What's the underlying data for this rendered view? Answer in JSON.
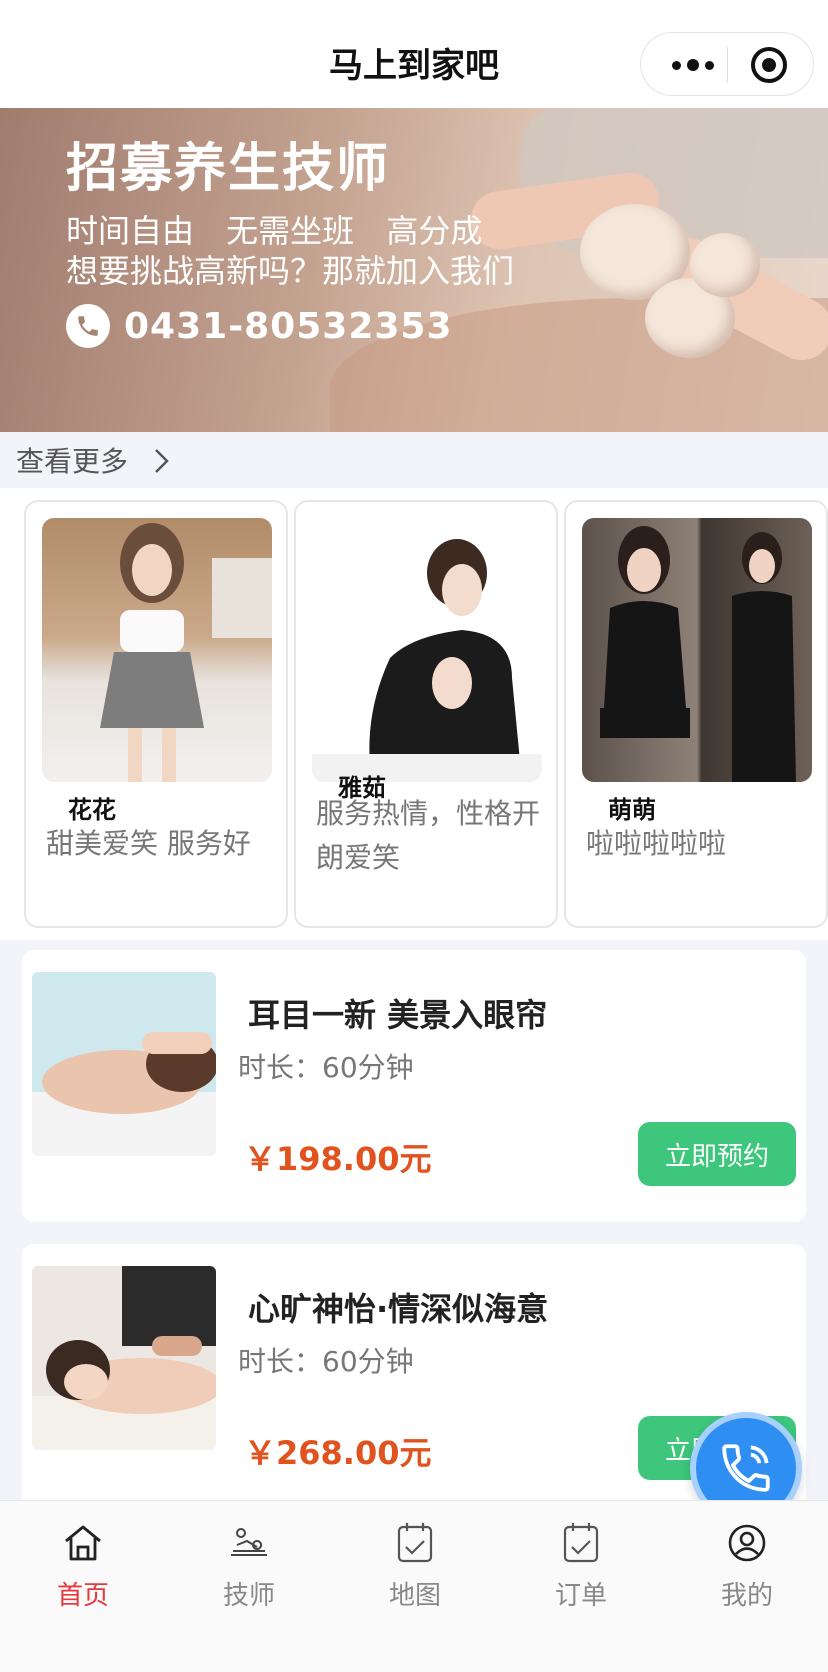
{
  "header": {
    "title": "马上到家吧"
  },
  "banner": {
    "title": "招募养生技师",
    "line1": "时间自由 无需坐班 高分成",
    "line2": "想要挑战高新吗？那就加入我们",
    "phone": "0431-80532353"
  },
  "see_more": {
    "label": "查看更多"
  },
  "technicians": [
    {
      "name": "花花",
      "desc": "甜美爱笑 服务好"
    },
    {
      "name": "雅茹",
      "desc": "服务热情，性格开朗爱笑"
    },
    {
      "name": "萌萌",
      "desc": "啦啦啦啦啦"
    }
  ],
  "services": [
    {
      "title": "耳目一新 美景入眼帘",
      "duration": "时长：60分钟",
      "price": "￥198.00元",
      "button": "立即预约"
    },
    {
      "title": "心旷神怡·情深似海意",
      "duration": "时长：60分钟",
      "price": "￥268.00元",
      "button": "立即预约"
    }
  ],
  "tabbar": [
    {
      "label": "首页",
      "icon": "home-icon",
      "active": true
    },
    {
      "label": "技师",
      "icon": "massage-icon",
      "active": false
    },
    {
      "label": "地图",
      "icon": "map-icon",
      "active": false
    },
    {
      "label": "订单",
      "icon": "order-icon",
      "active": false
    },
    {
      "label": "我的",
      "icon": "profile-icon",
      "active": false
    }
  ],
  "colors": {
    "accent_active": "#e5393f",
    "price": "#e0531e",
    "book_button": "#3dc67c",
    "call_button": "#2f8ef2"
  }
}
